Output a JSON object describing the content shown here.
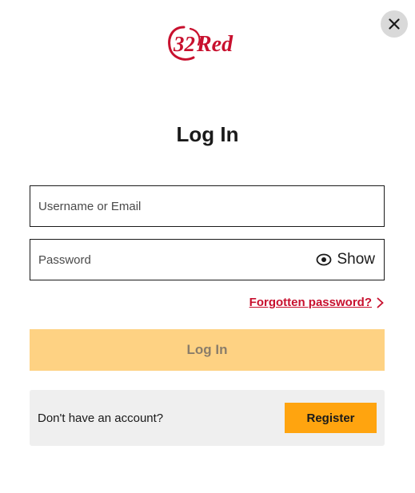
{
  "header": {
    "close_icon": "close-icon",
    "logo_text": "32Red"
  },
  "form": {
    "title": "Log In",
    "username": {
      "placeholder": "Username or Email",
      "value": ""
    },
    "password": {
      "placeholder": "Password",
      "value": "",
      "show_label": "Show",
      "show_icon": "eye-icon"
    },
    "forgot_label": "Forgotten password?",
    "forgot_icon": "chevron-right-icon",
    "login_label": "Log In"
  },
  "register": {
    "prompt": "Don't have an account?",
    "button_label": "Register"
  },
  "colors": {
    "brand_red": "#c8102e",
    "login_button_disabled": "#fed283",
    "register_button": "#ffa40f",
    "register_panel_bg": "#efefef"
  }
}
